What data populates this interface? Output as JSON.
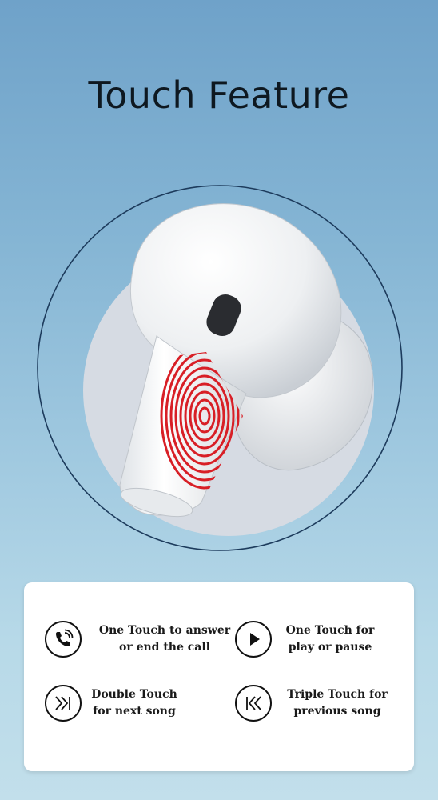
{
  "title": "Touch Feature",
  "colors": {
    "background_top": "#6fa2c9",
    "background_bottom": "#c2dfeb",
    "fingerprint": "#d81f26",
    "ring": "#1d3b5c"
  },
  "features": [
    {
      "icon": "phone-call-icon",
      "text": "One Touch to answer\nor end the call"
    },
    {
      "icon": "play-icon",
      "text": "One Touch for\nplay or pause"
    },
    {
      "icon": "next-track-icon",
      "text": "Double Touch\nfor next song"
    },
    {
      "icon": "previous-track-icon",
      "text": "Triple Touch for\nprevious song"
    }
  ]
}
